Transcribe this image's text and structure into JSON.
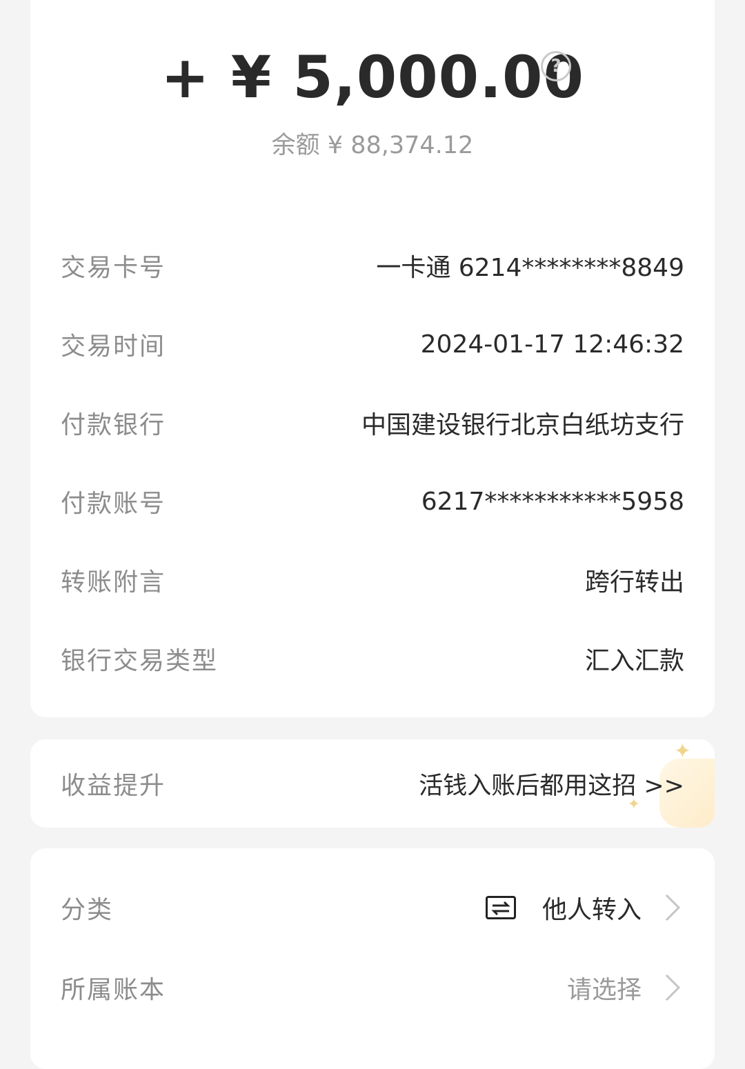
{
  "header": {
    "amount": "+ ¥ 5,000.00",
    "help_icon": "?",
    "balance": "余额 ¥ 88,374.12"
  },
  "details": [
    {
      "label": "交易卡号",
      "value": "一卡通 6214********8849"
    },
    {
      "label": "交易时间",
      "value": "2024-01-17 12:46:32"
    },
    {
      "label": "付款银行",
      "value": "中国建设银行北京白纸坊支行"
    },
    {
      "label": "付款账号",
      "value": "6217***********5958"
    },
    {
      "label": "转账附言",
      "value": "跨行转出"
    },
    {
      "label": "银行交易类型",
      "value": "汇入汇款"
    }
  ],
  "promo": {
    "label": "收益提升",
    "link": "活钱入账后都用这招 >>"
  },
  "classification": {
    "category_label": "分类",
    "category_icon": "transfer-icon",
    "category_value": "他人转入",
    "ledger_label": "所属账本",
    "ledger_value": "请选择"
  }
}
